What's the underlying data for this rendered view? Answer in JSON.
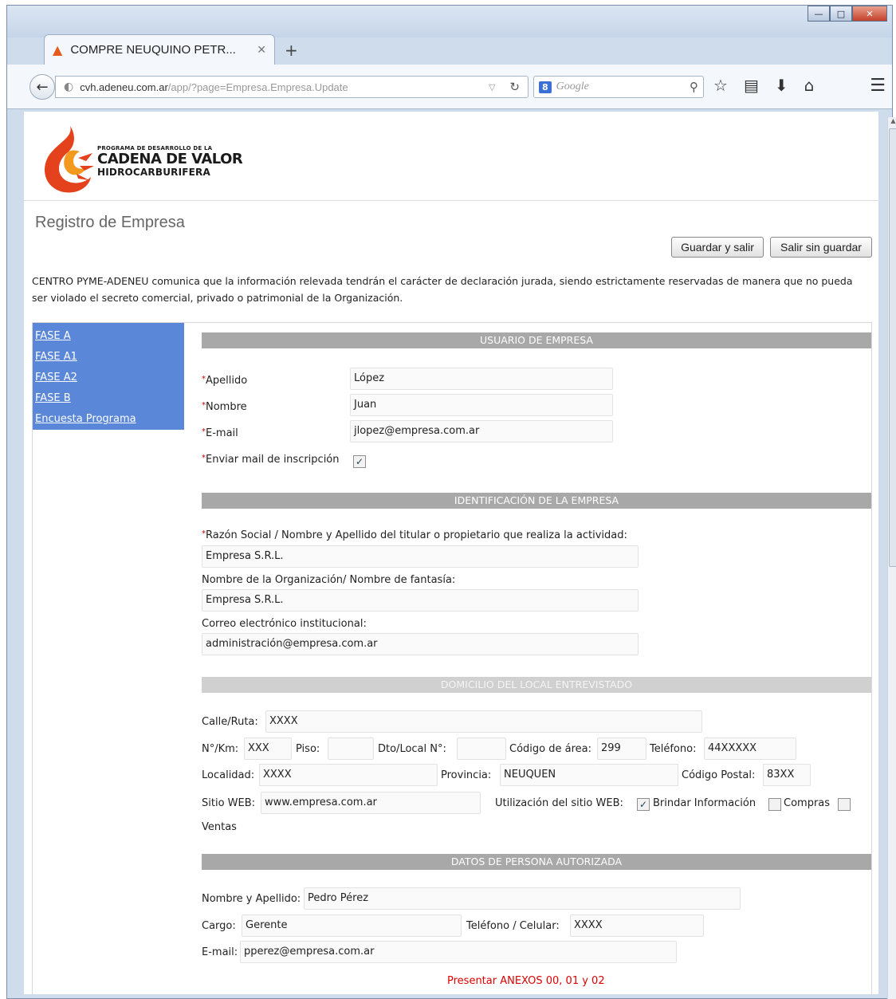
{
  "browser": {
    "tab_title": "COMPRE NEUQUINO PETR...",
    "url_host": "cvh.adeneu.com.ar",
    "url_path": "/app/?page=Empresa.Empresa.Update",
    "search_placeholder": "Google"
  },
  "header": {
    "logo_line1": "PROGRAMA DE DESARROLLO DE LA",
    "logo_line2": "CADENA DE VALOR",
    "logo_line3": "HIDROCARBURIFERA"
  },
  "page": {
    "title": "Registro de Empresa",
    "save_exit": "Guardar y salir",
    "exit_no_save": "Salir sin guardar",
    "notice": "CENTRO PYME-ADENEU comunica que la información relevada tendrán el carácter de declaración jurada, siendo estrictamente reservadas de manera que no pueda ser violado el secreto comercial, privado o patrimonial de la Organización."
  },
  "sidebar": {
    "items": [
      "FASE A",
      "FASE A1",
      "FASE A2",
      "FASE B",
      "Encuesta Programa"
    ]
  },
  "usuario": {
    "section": "USUARIO DE EMPRESA",
    "apellido_label": "Apellido",
    "apellido": "López",
    "nombre_label": "Nombre",
    "nombre": "Juan",
    "email_label": "E-mail",
    "email": "jlopez@empresa.com.ar",
    "enviar_label": "Enviar mail de inscripción"
  },
  "identificacion": {
    "section": "IDENTIFICACIÓN DE LA EMPRESA",
    "razon_label": "Razón Social / Nombre y Apellido del titular o propietario que realiza la actividad:",
    "razon": "Empresa S.R.L.",
    "org_label": "Nombre de la Organización/ Nombre de fantasía:",
    "org": "Empresa S.R.L.",
    "correo_label": "Correo electrónico institucional:",
    "correo": "administración@empresa.com.ar"
  },
  "domicilio": {
    "section": "DOMICILIO DEL LOCAL ENTREVISTADO",
    "calle_label": "Calle/Ruta:",
    "calle": "XXXX",
    "km_label": "N°/Km:",
    "km": "XXX",
    "piso_label": "Piso:",
    "piso": "",
    "dto_label": "Dto/Local N°:",
    "dto": "",
    "area_label": "Código de área:",
    "area": "299",
    "tel_label": "Teléfono:",
    "tel": "44XXXXX",
    "localidad_label": "Localidad:",
    "localidad": "XXXX",
    "provincia_label": "Provincia:",
    "provincia": "NEUQUEN",
    "cp_label": "Código Postal:",
    "cp": "83XX",
    "web_label": "Sitio WEB:",
    "web": "www.empresa.com.ar",
    "uso_label": "Utilización del sitio WEB:",
    "uso_info": "Brindar Información",
    "uso_compras": "Compras",
    "uso_ventas": "Ventas"
  },
  "autorizada": {
    "section": "DATOS DE PERSONA AUTORIZADA",
    "nombre_label": "Nombre y Apellido:",
    "nombre": "Pedro Pérez",
    "cargo_label": "Cargo:",
    "cargo": "Gerente",
    "tel_label": "Teléfono / Celular:",
    "tel": "XXXX",
    "email_label": "E-mail:",
    "email": "pperez@empresa.com.ar"
  },
  "annex_note": "Presentar ANEXOS 00, 01 y 02",
  "checkboxes": {
    "enviar_mail": true,
    "brindar_informacion": true,
    "compras": false,
    "ventas": false
  }
}
